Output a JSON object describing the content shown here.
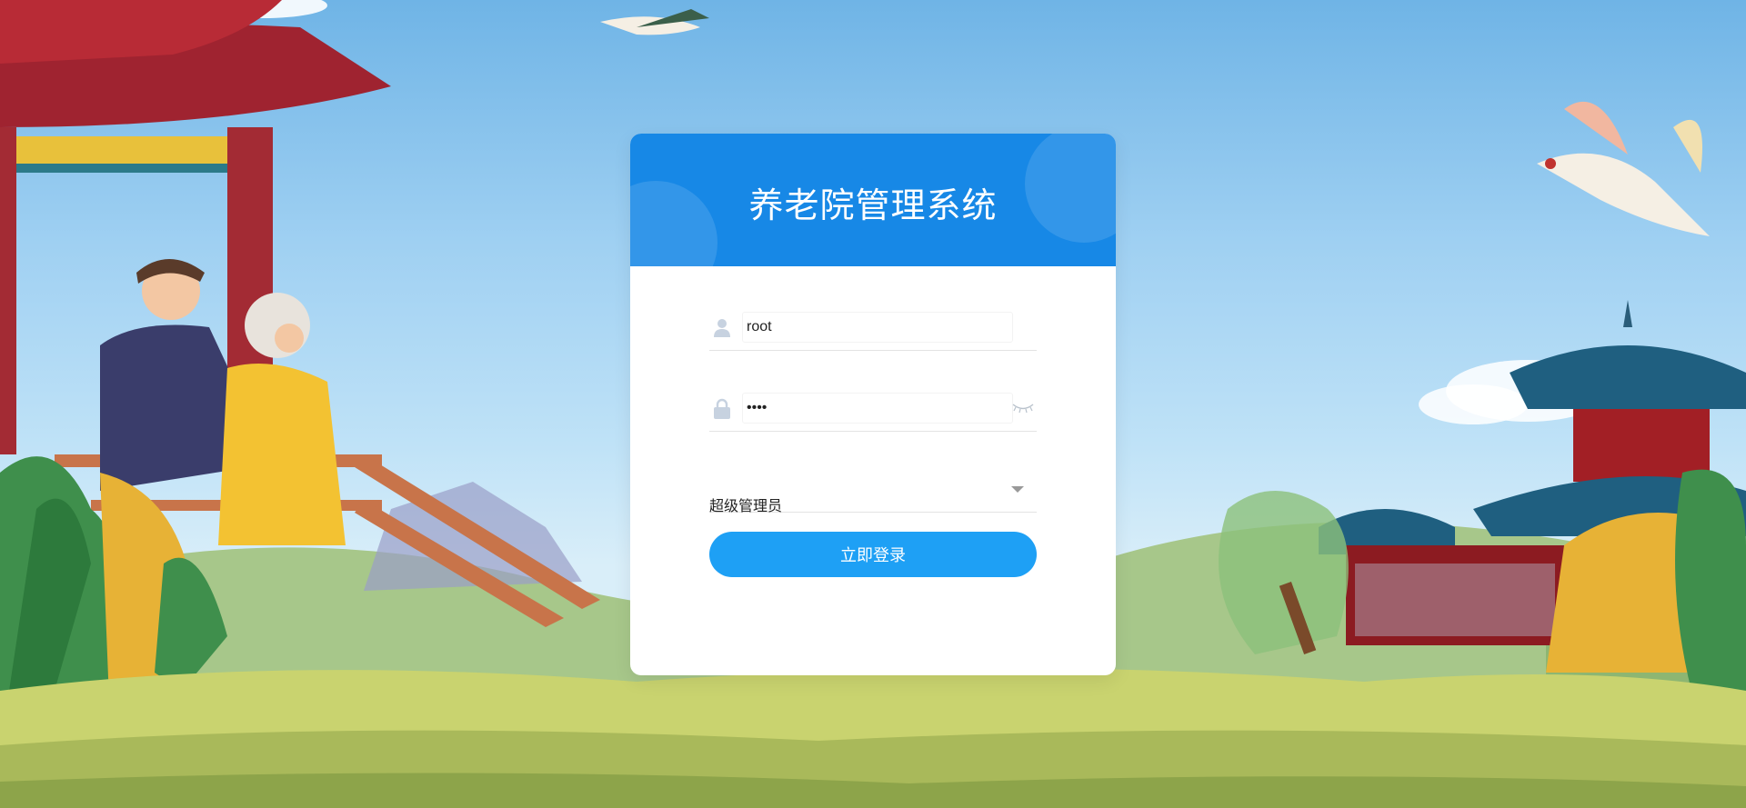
{
  "app": {
    "title": "养老院管理系统"
  },
  "login": {
    "username_value": "root",
    "password_value": "••••",
    "role_selected": "超级管理员",
    "submit_label": "立即登录"
  },
  "colors": {
    "header": "#1788e6",
    "button": "#1ea0f5",
    "sky": "#9fd0f2"
  },
  "icons": {
    "user": "user-icon",
    "lock": "lock-icon",
    "eye": "eye-closed-icon",
    "caret": "chevron-down-icon"
  }
}
